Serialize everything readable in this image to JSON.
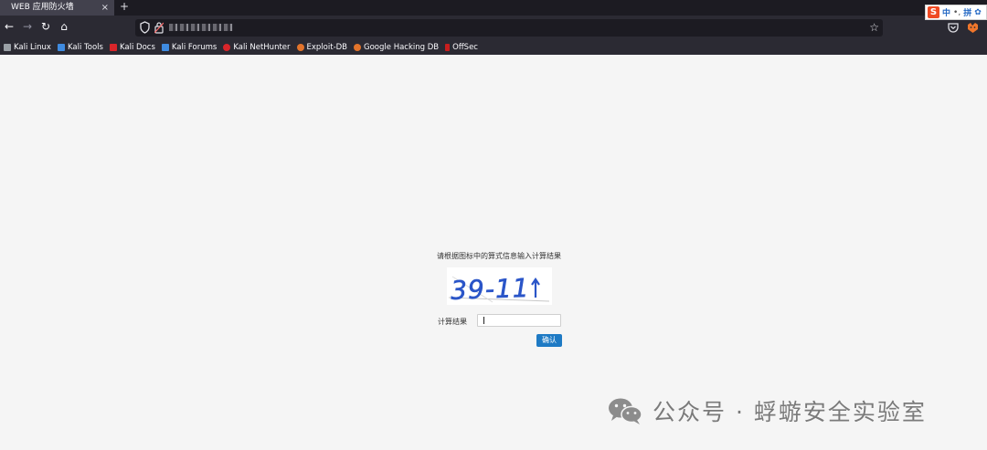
{
  "browser": {
    "tab_title": "WEB 应用防火墙",
    "tab_close": "×",
    "new_tab": "+",
    "nav": {
      "back": "←",
      "forward": "→",
      "reload": "↻",
      "home": "⌂"
    },
    "bookmark_star": "☆",
    "ime": {
      "logo": "S",
      "mode": "中",
      "dots": "•,",
      "pinyin": "拼",
      "extra": "✿"
    }
  },
  "bookmarks": [
    {
      "label": "Kali Linux",
      "icon": "kali-dragon-icon",
      "color": "#9aa0a6"
    },
    {
      "label": "Kali Tools",
      "icon": "kali-tools-icon",
      "color": "#3f8be0"
    },
    {
      "label": "Kali Docs",
      "icon": "kali-docs-icon",
      "color": "#d9252a"
    },
    {
      "label": "Kali Forums",
      "icon": "kali-forums-icon",
      "color": "#3f8be0"
    },
    {
      "label": "Kali NetHunter",
      "icon": "nethunter-icon",
      "color": "#d9252a"
    },
    {
      "label": "Exploit-DB",
      "icon": "exploit-db-icon",
      "color": "#e3742b"
    },
    {
      "label": "Google Hacking DB",
      "icon": "ghdb-icon",
      "color": "#e3742b"
    },
    {
      "label": "OffSec",
      "icon": "offsec-icon",
      "color": "#c81e1e"
    }
  ],
  "page": {
    "prompt": "请根据图标中的算式信息输入计算结果",
    "captcha_text": "39-11",
    "captcha_color": "#2a55c8",
    "result_label": "计算结果",
    "result_value": "",
    "confirm_label": "确认",
    "confirm_color": "#1e7ac4"
  },
  "watermark": {
    "text": "公众号 · 蜉蝣安全实验室",
    "icon": "wechat-icon"
  }
}
